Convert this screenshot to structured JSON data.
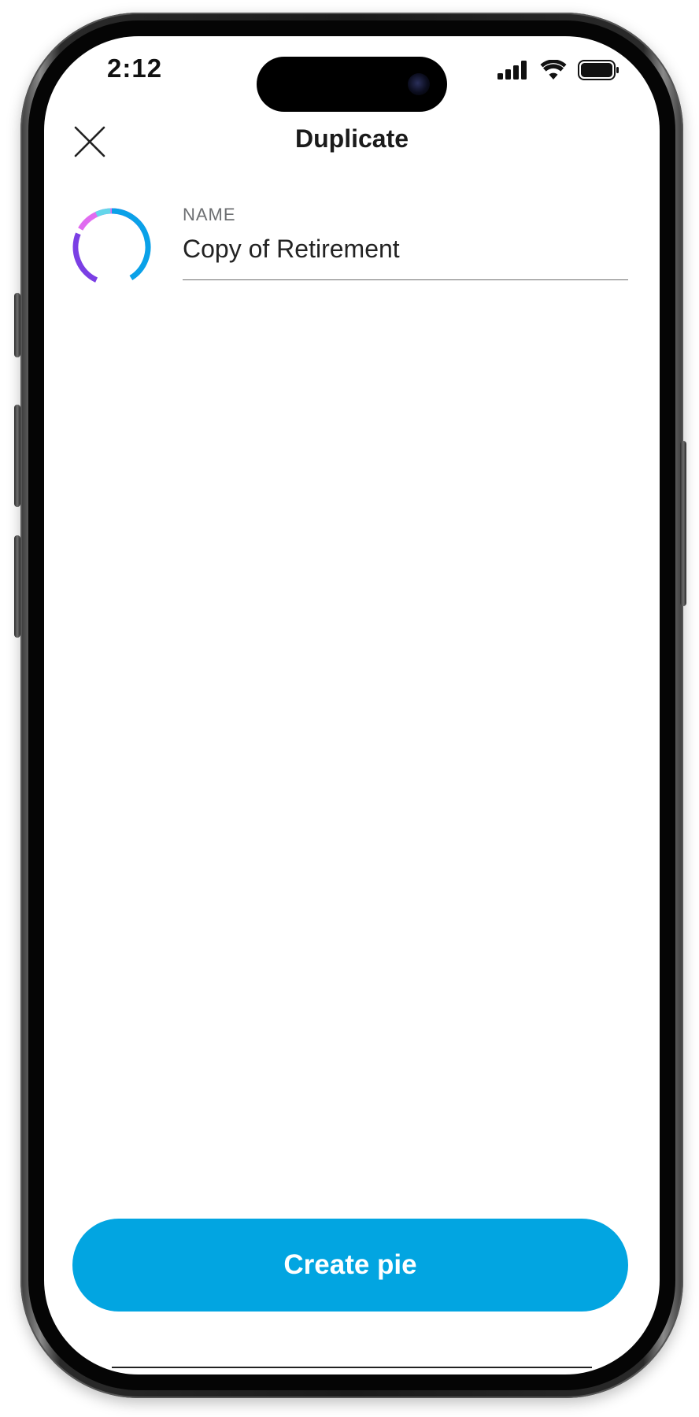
{
  "status_bar": {
    "time": "2:12"
  },
  "header": {
    "title": "Duplicate",
    "close_icon": "close-icon"
  },
  "pie": {
    "icon": "pie-ring-icon",
    "ring_colors": [
      "#7b3fe4",
      "#e06bf0",
      "#0aa1e8",
      "#64d6ea"
    ]
  },
  "form": {
    "name_label": "NAME",
    "name_value": "Copy of Retirement"
  },
  "footer": {
    "create_label": "Create pie",
    "button_color": "#02a5e1"
  }
}
